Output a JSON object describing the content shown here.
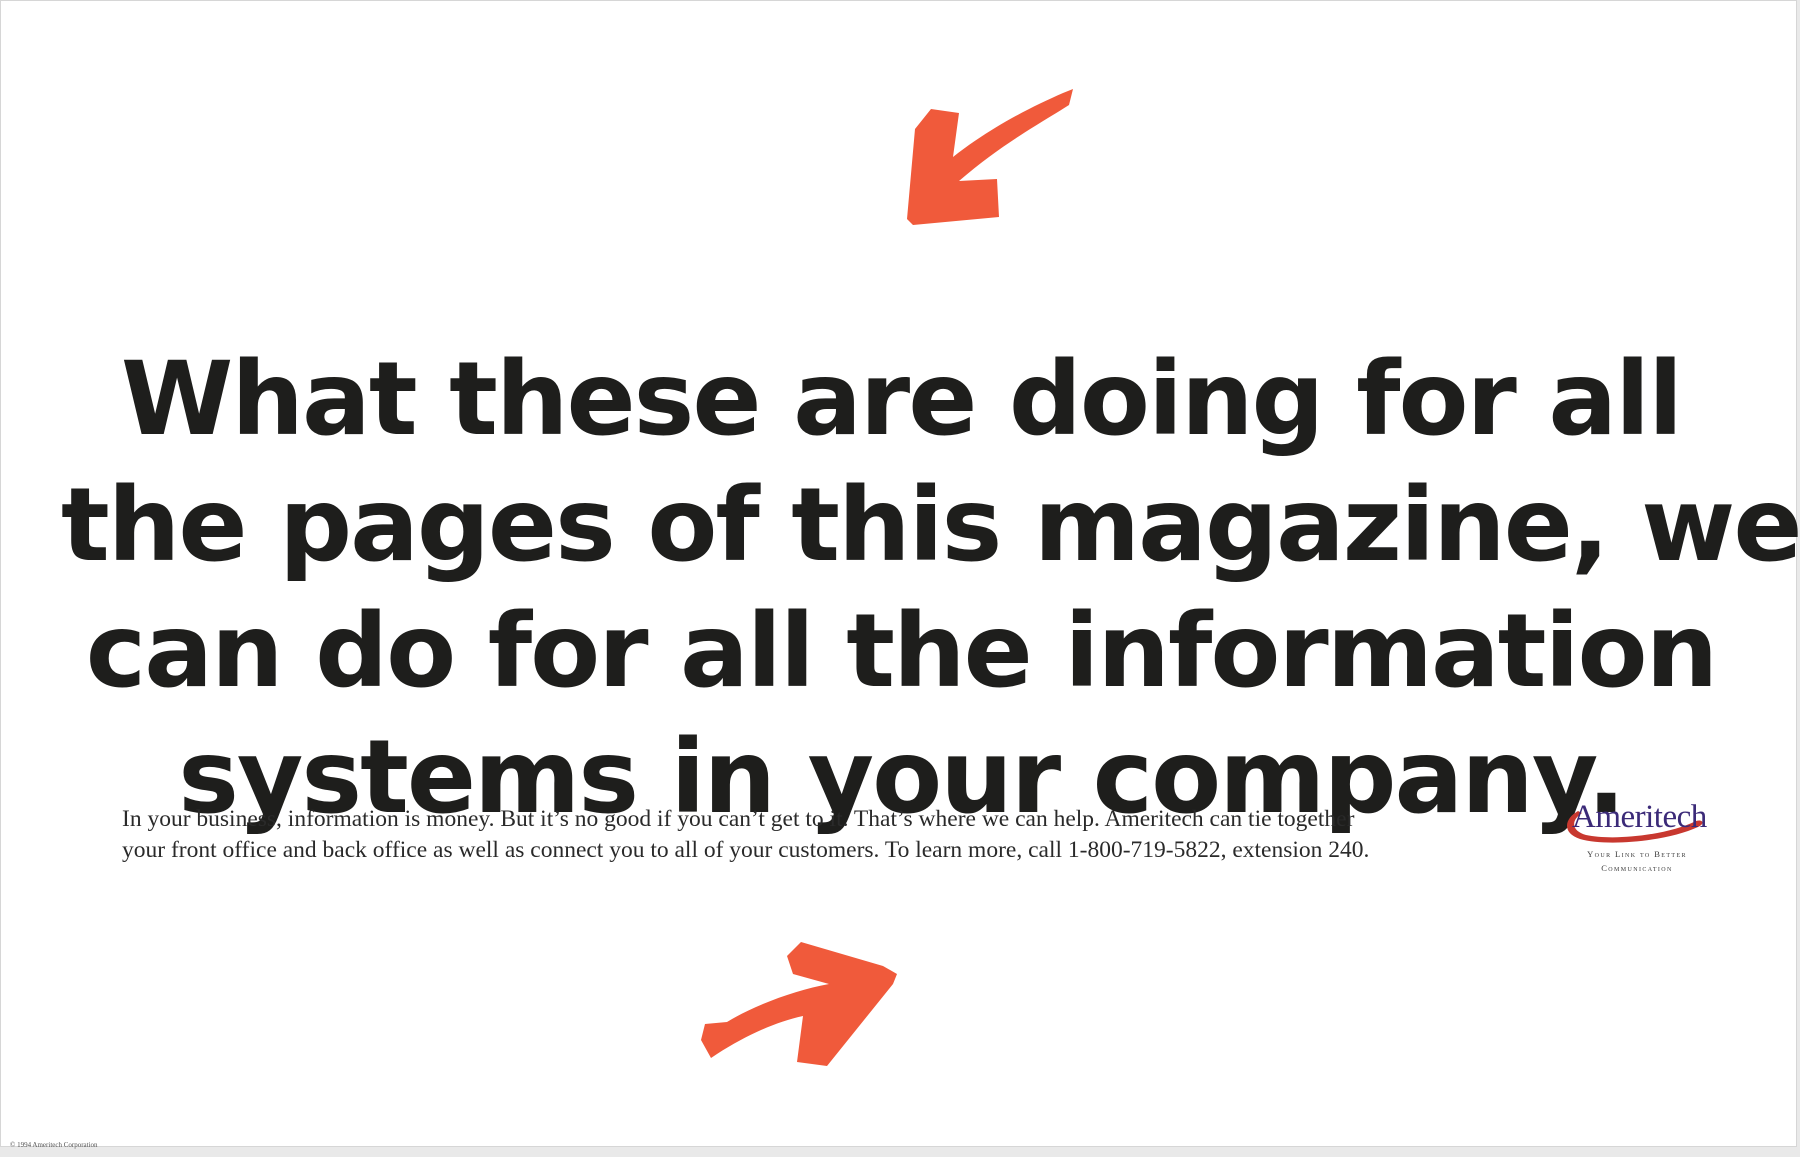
{
  "colors": {
    "arrow": "#f05a3b",
    "headline": "#1e1e1c",
    "body_text": "#2a2a2a",
    "logo_text": "#3b2a78",
    "logo_swoosh": "#c8382f",
    "page_background": "#ffffff"
  },
  "arrows": {
    "top_icon": "arrow-pointing-up-left-icon",
    "bottom_icon": "arrow-pointing-up-right-icon"
  },
  "headline": {
    "lines": [
      "What these are doing for all",
      "the pages of this magazine, we",
      "can do for all the information",
      "systems in your company."
    ]
  },
  "body_copy": {
    "lines": [
      "In your business, information is money. But it’s no good if you can’t get to it. That’s where we can help. Ameritech can tie together",
      "your front office and back office as well as connect you to all of your customers. To learn more, call 1-800-719-5822, extension 240."
    ]
  },
  "logo": {
    "wordmark": "Ameritech",
    "tagline": "Your Link to Better Communication",
    "swoosh_icon": "oval-swoosh-icon"
  },
  "footer": {
    "copyright": "© 1994 Ameritech Corporation"
  }
}
